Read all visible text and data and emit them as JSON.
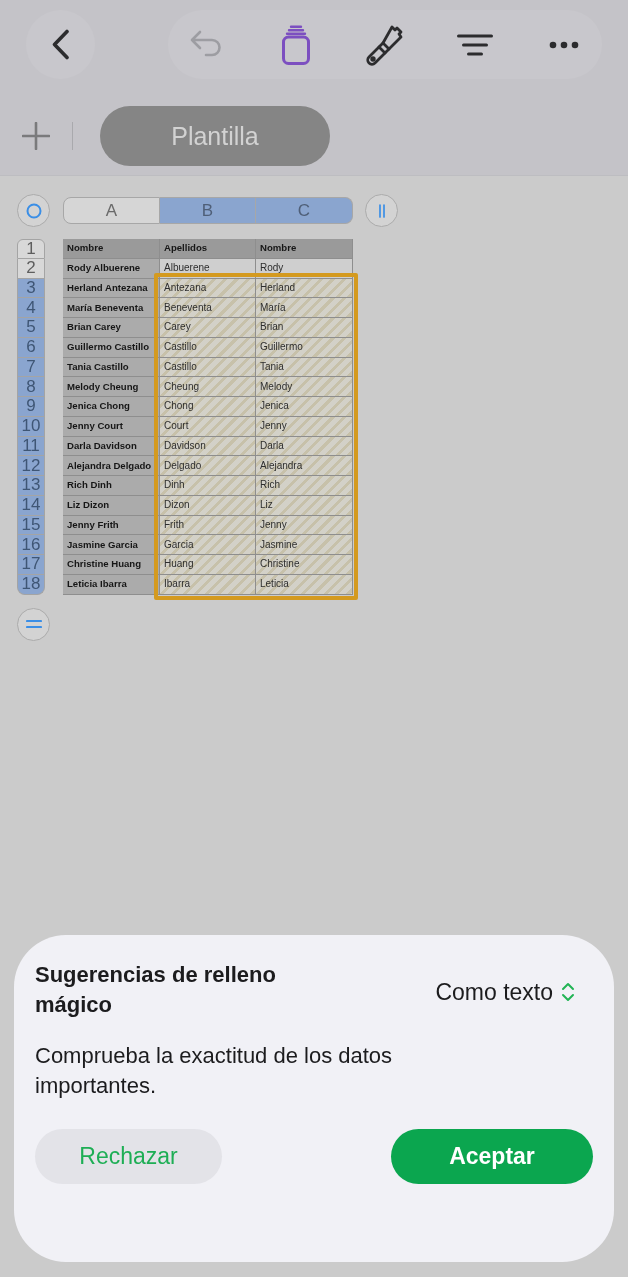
{
  "toolbar": [
    {
      "kind": "back",
      "disabled": false
    },
    {
      "kind": "undo",
      "disabled": true
    },
    {
      "kind": "organize",
      "disabled": false
    },
    {
      "kind": "format",
      "disabled": false
    },
    {
      "kind": "sort",
      "disabled": false
    },
    {
      "kind": "more",
      "disabled": false
    }
  ],
  "sheet_tabs": [
    {
      "label": "Plantilla",
      "selected": true
    }
  ],
  "table": {
    "columns": [
      {
        "label": "A",
        "selected": false
      },
      {
        "label": "B",
        "selected": true
      },
      {
        "label": "C",
        "selected": true
      }
    ],
    "rows": [
      {
        "number": "1",
        "kind": "header",
        "selected": false,
        "suggested": false,
        "cells": [
          "Nombre",
          "Apellidos",
          "Nombre"
        ]
      },
      {
        "number": "2",
        "kind": "data",
        "selected": false,
        "suggested": false,
        "cells": [
          "Rody Albuerene",
          "Albuerene",
          "Rody"
        ]
      },
      {
        "number": "3",
        "kind": "data",
        "selected": true,
        "suggested": true,
        "cells": [
          "Herland Antezana",
          "Antezana",
          "Herland"
        ]
      },
      {
        "number": "4",
        "kind": "data",
        "selected": true,
        "suggested": true,
        "cells": [
          "María Beneventa",
          "Beneventa",
          "María"
        ]
      },
      {
        "number": "5",
        "kind": "data",
        "selected": true,
        "suggested": true,
        "cells": [
          "Brian Carey",
          "Carey",
          "Brian"
        ]
      },
      {
        "number": "6",
        "kind": "data",
        "selected": true,
        "suggested": true,
        "cells": [
          "Guillermo Castillo",
          "Castillo",
          "Guillermo"
        ]
      },
      {
        "number": "7",
        "kind": "data",
        "selected": true,
        "suggested": true,
        "cells": [
          "Tania Castillo",
          "Castillo",
          "Tania"
        ]
      },
      {
        "number": "8",
        "kind": "data",
        "selected": true,
        "suggested": true,
        "cells": [
          "Melody Cheung",
          "Cheung",
          "Melody"
        ]
      },
      {
        "number": "9",
        "kind": "data",
        "selected": true,
        "suggested": true,
        "cells": [
          "Jenica Chong",
          "Chong",
          "Jenica"
        ]
      },
      {
        "number": "10",
        "kind": "data",
        "selected": true,
        "suggested": true,
        "cells": [
          "Jenny Court",
          "Court",
          "Jenny"
        ]
      },
      {
        "number": "11",
        "kind": "data",
        "selected": true,
        "suggested": true,
        "cells": [
          "Darla Davidson",
          "Davidson",
          "Darla"
        ]
      },
      {
        "number": "12",
        "kind": "data",
        "selected": true,
        "suggested": true,
        "cells": [
          "Alejandra Delgado",
          "Delgado",
          "Alejandra"
        ]
      },
      {
        "number": "13",
        "kind": "data",
        "selected": true,
        "suggested": true,
        "cells": [
          "Rich Dinh",
          "Dinh",
          "Rich"
        ]
      },
      {
        "number": "14",
        "kind": "data",
        "selected": true,
        "suggested": true,
        "cells": [
          "Liz Dizon",
          "Dizon",
          "Liz"
        ]
      },
      {
        "number": "15",
        "kind": "data",
        "selected": true,
        "suggested": true,
        "cells": [
          "Jenny Frith",
          "Frith",
          "Jenny"
        ]
      },
      {
        "number": "16",
        "kind": "data",
        "selected": true,
        "suggested": true,
        "cells": [
          "Jasmine Garcia",
          "Garcia",
          "Jasmine"
        ]
      },
      {
        "number": "17",
        "kind": "data",
        "selected": true,
        "suggested": true,
        "cells": [
          "Christine Huang",
          "Huang",
          "Christine"
        ]
      },
      {
        "number": "18",
        "kind": "data",
        "selected": true,
        "suggested": true,
        "cells": [
          "Leticia Ibarra",
          "Ibarra",
          "Leticia"
        ]
      }
    ]
  },
  "suggestion_sheet": {
    "title": "Sugerencias de relleno mágico",
    "format_menu": "Como texto",
    "message": "Comprueba la exactitud de los datos importantes.",
    "buttons": [
      {
        "kind": "secondary",
        "label": "Rechazar"
      },
      {
        "kind": "primary",
        "label": "Aceptar"
      }
    ]
  }
}
